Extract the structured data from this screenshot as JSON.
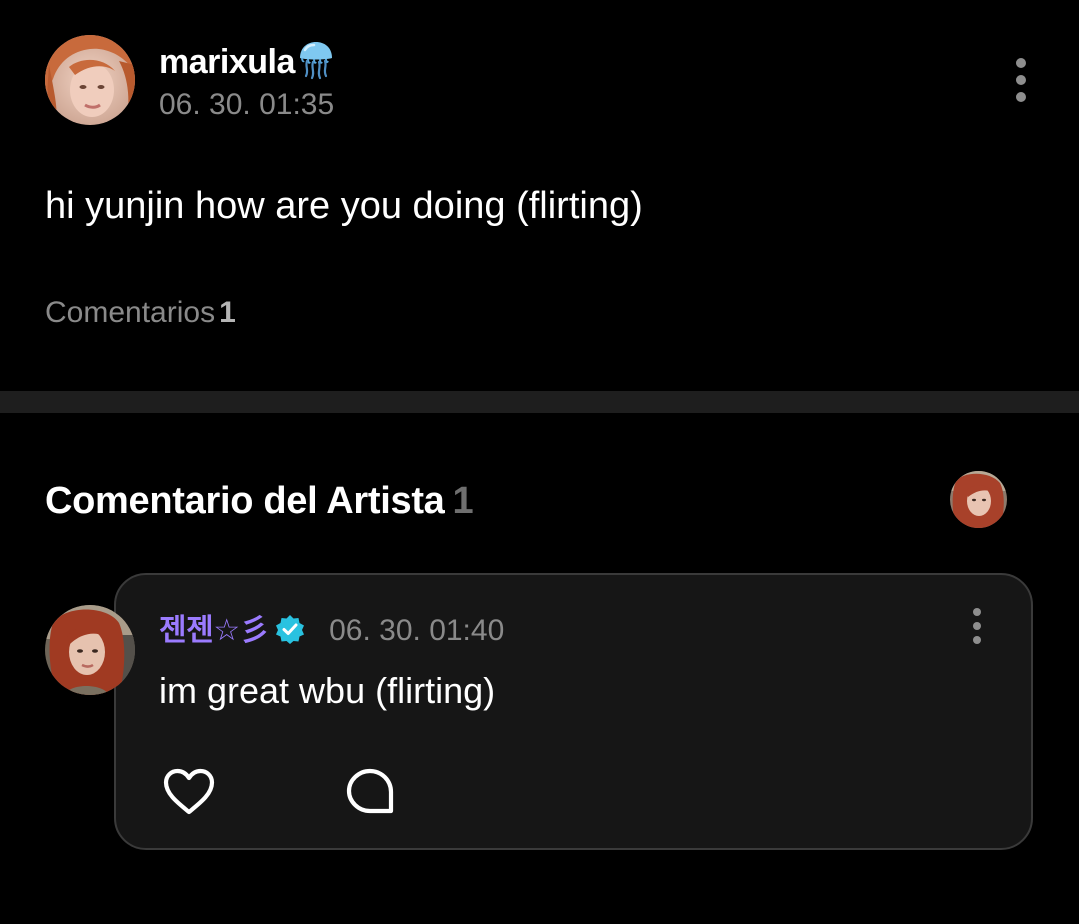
{
  "post": {
    "author": "marixula",
    "author_badge_icon": "jellyfish-icon",
    "timestamp": "06. 30. 01:35",
    "body": "hi yunjin how are you doing (flirting)",
    "comments_label": "Comentarios",
    "comments_count": "1",
    "more_icon": "more-vertical-icon"
  },
  "artist_section": {
    "heading": "Comentario del Artista",
    "count": "1"
  },
  "artist_comment": {
    "author": "젠젠☆彡",
    "verified_icon": "verified-check-icon",
    "timestamp": "06. 30. 01:40",
    "body": "im great wbu (flirting)",
    "actions": [
      "heart-icon",
      "reply-bubble-icon"
    ],
    "more_icon": "more-vertical-icon"
  },
  "colors": {
    "background": "#000000",
    "card_background": "#161616",
    "card_border": "#3a3a3a",
    "divider": "#1e1e1e",
    "artist_name": "#9b7bff",
    "verified_badge": "#29c2e0",
    "secondary_text": "#8a8a8a"
  }
}
